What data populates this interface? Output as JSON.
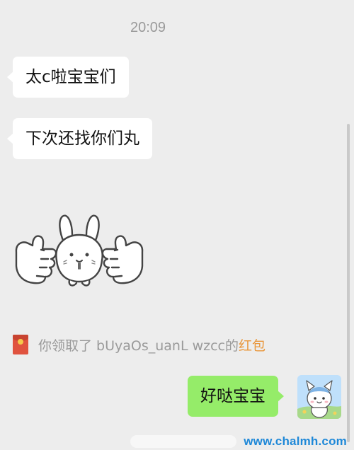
{
  "chat": {
    "timestamp": "20:09",
    "messages": [
      {
        "side": "left",
        "type": "text",
        "text": "太c啦宝宝们"
      },
      {
        "side": "left",
        "type": "text",
        "text": "下次还找你们丸"
      },
      {
        "side": "left",
        "type": "sticker",
        "icon": "bunny-thumbs-up-sticker"
      },
      {
        "side": "right",
        "type": "text",
        "text": "好哒宝宝"
      }
    ]
  },
  "system_notice": {
    "prefix": "你领取了 bUyaOs_uanL wzcc的",
    "link_text": "红包",
    "icon": "red-packet-icon",
    "link_color": "#e9963a"
  },
  "colors": {
    "background": "#ededed",
    "incoming_bubble": "#ffffff",
    "outgoing_bubble": "#95ec69"
  },
  "watermark": {
    "text": "www.chalmh.com"
  }
}
